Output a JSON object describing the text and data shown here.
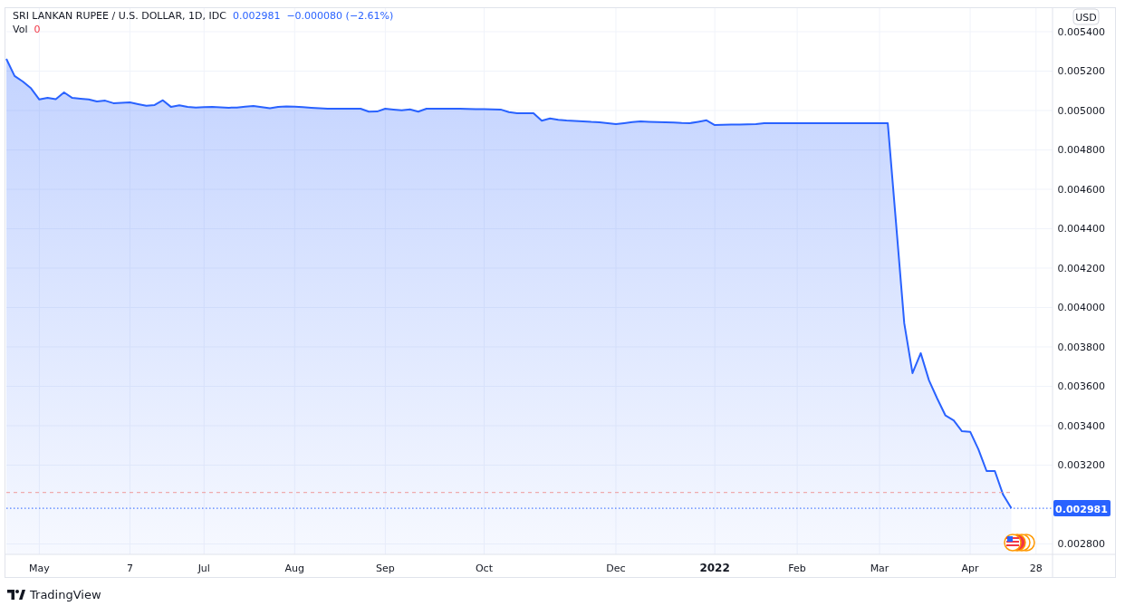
{
  "legend": {
    "symbol": "SRI LANKAN RUPEE / U.S. DOLLAR, 1D, IDC",
    "last": "0.002981",
    "change": "−0.000080 (−2.61%)",
    "volume_label": "Vol",
    "volume": "0"
  },
  "price_scale": {
    "currency": "USD"
  },
  "chart_data": {
    "type": "area",
    "categories": [
      null,
      null,
      null,
      null,
      "May",
      null,
      null,
      null,
      null,
      null,
      null,
      null,
      null,
      null,
      null,
      "7",
      null,
      null,
      null,
      null,
      null,
      null,
      null,
      null,
      "Jul",
      null,
      null,
      null,
      null,
      null,
      null,
      null,
      null,
      null,
      null,
      "Aug",
      null,
      null,
      null,
      null,
      null,
      null,
      null,
      null,
      null,
      null,
      "Sep",
      null,
      null,
      null,
      null,
      null,
      null,
      null,
      null,
      null,
      null,
      null,
      "Oct",
      null,
      null,
      null,
      null,
      null,
      null,
      null,
      null,
      null,
      null,
      null,
      null,
      null,
      null,
      null,
      "Dec",
      null,
      null,
      null,
      null,
      null,
      null,
      null,
      null,
      null,
      null,
      null,
      "2022",
      null,
      null,
      null,
      null,
      null,
      null,
      null,
      null,
      null,
      "Feb",
      null,
      null,
      null,
      null,
      null,
      null,
      null,
      null,
      null,
      "Mar",
      null,
      null,
      null,
      null,
      null,
      null,
      null,
      null,
      null,
      null,
      "Apr",
      null,
      null,
      null,
      null,
      null,
      null,
      null,
      "28",
      null
    ],
    "series": [
      {
        "color": "#2962ff",
        "values": [
          0.005262,
          0.005175,
          0.005147,
          0.005112,
          0.005056,
          0.005064,
          0.005057,
          0.005092,
          0.005064,
          0.00506,
          0.005056,
          0.005046,
          0.00505,
          0.005037,
          0.005039,
          0.005041,
          0.005032,
          0.005024,
          0.005028,
          0.005052,
          0.005018,
          0.005026,
          0.005018,
          0.005015,
          0.005017,
          0.005018,
          0.005016,
          0.005014,
          0.005015,
          0.005019,
          0.005023,
          0.005017,
          0.005011,
          0.005018,
          0.005021,
          0.005019,
          0.005017,
          0.005014,
          0.005012,
          0.005009,
          0.005009,
          0.005009,
          0.005009,
          0.005009,
          0.004994,
          0.004995,
          0.005009,
          0.005005,
          0.005001,
          0.005006,
          0.004994,
          0.005009,
          0.005009,
          0.005009,
          0.005009,
          0.005009,
          0.005008,
          0.005007,
          0.005007,
          0.005006,
          0.005005,
          0.004992,
          0.004986,
          0.004986,
          0.004986,
          0.004948,
          0.00496,
          0.004953,
          0.004949,
          0.004947,
          0.004945,
          0.004942,
          0.00494,
          0.004936,
          0.004931,
          0.004936,
          0.004941,
          0.004945,
          0.004943,
          0.004941,
          0.00494,
          0.004939,
          0.004937,
          0.004936,
          0.004943,
          0.00495,
          0.004926,
          0.004927,
          0.004928,
          0.004929,
          0.00493,
          0.004931,
          0.004935,
          0.004936,
          0.004936,
          0.004936,
          0.004936,
          0.004936,
          0.004936,
          0.004936,
          0.004936,
          0.004936,
          0.004936,
          0.004936,
          0.004936,
          0.004936,
          0.004936,
          0.004936,
          0.00443,
          0.00392,
          0.003667,
          0.003768,
          0.00363,
          0.003538,
          0.003452,
          0.003427,
          0.003372,
          0.003369,
          0.003281,
          0.00317,
          0.00317,
          0.00305,
          0.002981,
          null,
          null,
          null,
          null
        ]
      }
    ],
    "ylim": [
      0.002747,
      0.005524
    ],
    "yticks": [
      {
        "value": 0.0054,
        "label": "0.005400"
      },
      {
        "value": 0.0052,
        "label": "0.005200"
      },
      {
        "value": 0.005,
        "label": "0.005000"
      },
      {
        "value": 0.0048,
        "label": "0.004800"
      },
      {
        "value": 0.0046,
        "label": "0.004600"
      },
      {
        "value": 0.0044,
        "label": "0.004400"
      },
      {
        "value": 0.0042,
        "label": "0.004200"
      },
      {
        "value": 0.004,
        "label": "0.004000"
      },
      {
        "value": 0.0038,
        "label": "0.003800"
      },
      {
        "value": 0.0036,
        "label": "0.003600"
      },
      {
        "value": 0.0034,
        "label": "0.003400"
      },
      {
        "value": 0.0032,
        "label": "0.003200"
      },
      {
        "value": 0.0028,
        "label": "0.002800"
      }
    ],
    "grid": true,
    "ref_lines": [
      {
        "axis": "y",
        "value": 0.003061
      },
      {
        "axis": "y",
        "value": 0.002981,
        "label": "0.002981"
      }
    ]
  },
  "footer": {
    "brand": "TradingView"
  }
}
